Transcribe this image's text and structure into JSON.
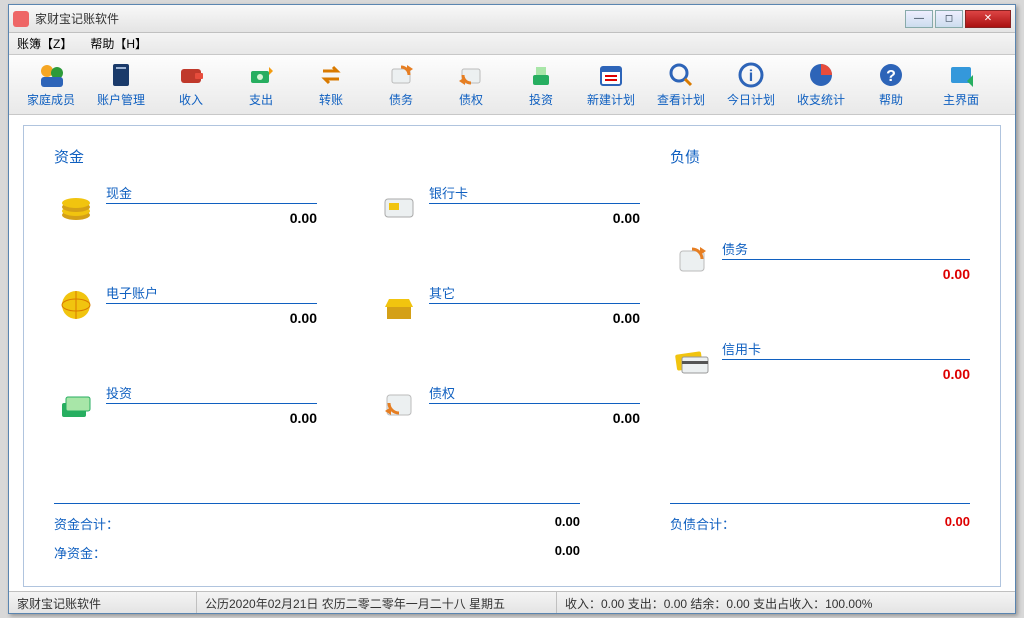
{
  "window": {
    "title": "家财宝记账软件"
  },
  "menu": {
    "ledger": "账簿【Z】",
    "help": "帮助【H】"
  },
  "toolbar": [
    {
      "id": "family",
      "label": "家庭成员"
    },
    {
      "id": "account",
      "label": "账户管理"
    },
    {
      "id": "income",
      "label": "收入"
    },
    {
      "id": "expense",
      "label": "支出"
    },
    {
      "id": "transfer",
      "label": "转账"
    },
    {
      "id": "debt",
      "label": "债务"
    },
    {
      "id": "credit",
      "label": "债权"
    },
    {
      "id": "invest",
      "label": "投资"
    },
    {
      "id": "newplan",
      "label": "新建计划"
    },
    {
      "id": "viewplan",
      "label": "查看计划"
    },
    {
      "id": "today",
      "label": "今日计划"
    },
    {
      "id": "stats",
      "label": "收支统计"
    },
    {
      "id": "help",
      "label": "帮助"
    },
    {
      "id": "home",
      "label": "主界面"
    }
  ],
  "sections": {
    "assets": "资金",
    "liab": "负债"
  },
  "assets": {
    "cash": {
      "label": "现金",
      "value": "0.00"
    },
    "bank": {
      "label": "银行卡",
      "value": "0.00"
    },
    "eacct": {
      "label": "电子账户",
      "value": "0.00"
    },
    "other": {
      "label": "其它",
      "value": "0.00"
    },
    "invest": {
      "label": "投资",
      "value": "0.00"
    },
    "credit": {
      "label": "债权",
      "value": "0.00"
    }
  },
  "liab": {
    "debt": {
      "label": "债务",
      "value": "0.00"
    },
    "card": {
      "label": "信用卡",
      "value": "0.00"
    }
  },
  "totals": {
    "assets_label": "资金合计：",
    "assets_value": "0.00",
    "liab_label": "负债合计：",
    "liab_value": "0.00",
    "net_label": "净资金：",
    "net_value": "0.00"
  },
  "status": {
    "app": "家财宝记账软件",
    "date": "公历2020年02月21日 农历二零二零年一月二十八 星期五",
    "summary": "收入：0.00 支出：0.00 结余：0.00 支出占收入：100.00%"
  }
}
